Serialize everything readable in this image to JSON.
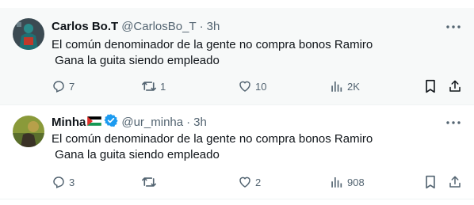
{
  "tweets": [
    {
      "name": "Carlos Bo.T",
      "handle": "@CarlosBo_T",
      "separator": "·",
      "time": "3h",
      "text": "El común denominador de la gente no compra bonos Ramiro\n Gana la guita siendo empleado",
      "replies": "7",
      "retweets": "1",
      "likes": "10",
      "views": "2K",
      "verified": false,
      "flag": false
    },
    {
      "name": "Minha",
      "handle": "@ur_minha",
      "separator": "·",
      "time": "3h",
      "text": "El común denominador de la gente no compra bonos Ramiro\n Gana la guita siendo empleado",
      "replies": "3",
      "retweets": "",
      "likes": "2",
      "views": "908",
      "verified": true,
      "flag": true
    }
  ],
  "colors": {
    "text": "#0f1419",
    "secondary": "#536471",
    "verified": "#1d9bf0",
    "hover_bg": "#f7f9f9"
  },
  "icons": [
    "avatar",
    "palestine-flag-icon",
    "verified-badge-icon",
    "more-icon",
    "reply-icon",
    "retweet-icon",
    "like-icon",
    "views-icon",
    "bookmark-icon",
    "share-icon"
  ]
}
